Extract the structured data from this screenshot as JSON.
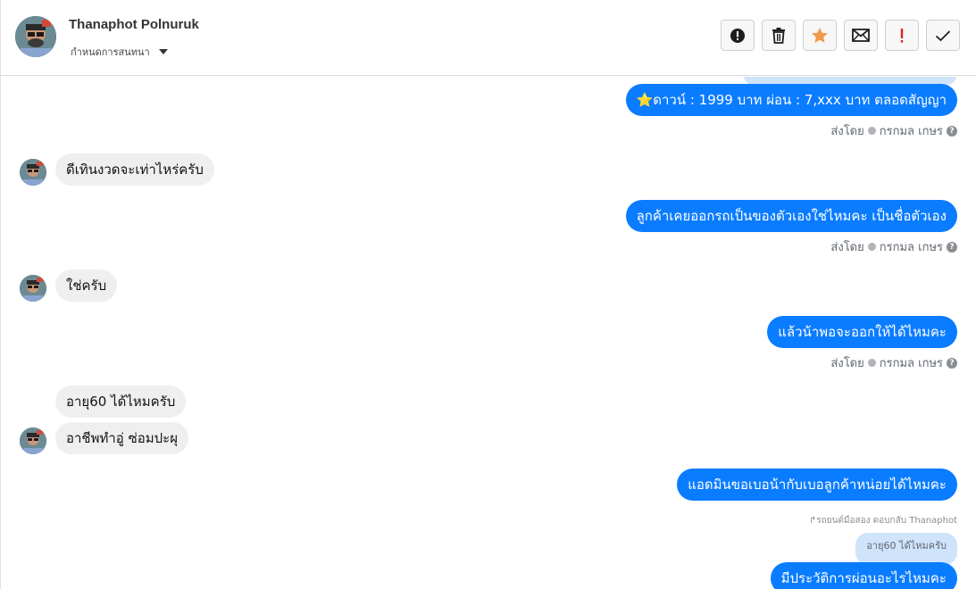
{
  "header": {
    "name": "Thanaphot Polnuruk",
    "assign_label": "กำหนดการสนทนา"
  },
  "actions": [
    {
      "name": "alert-icon",
      "color": "#1c1e21"
    },
    {
      "name": "trash-icon",
      "color": "#1c1e21"
    },
    {
      "name": "star-icon",
      "color": "#f2994a"
    },
    {
      "name": "mail-icon",
      "color": "#1c1e21"
    },
    {
      "name": "exclamation-icon",
      "color": "#e02020"
    },
    {
      "name": "check-icon",
      "color": "#1c1e21"
    }
  ],
  "colors": {
    "outgoing_bubble": "#0a7cff",
    "incoming_bubble": "#efefef",
    "quoted_bubble": "#cfe3fb"
  },
  "messages": {
    "out1": "⭐ดาวน์ : 1999 บาท ผ่อน : 7,xxx บาท ตลอดสัญญา",
    "in1": "ดีเทินงวดจะเท่าไหร่ครับ",
    "out2": "ลูกค้าเคยออกรถเป็นของตัวเองใช่ไหมคะ เป็นชื่อตัวเอง",
    "in2": "ใช่ครับ",
    "out3": "แล้วน้าพอจะออกให้ได้ไหมคะ",
    "in3a": "อายุ60 ได้ไหมครับ",
    "in3b": "อาชีพทำอู่ ซ่อมปะผุ",
    "out4": "แอดมินขอเบอน้ากับเบอลูกค้าหน่อยได้ไหมคะ",
    "reply_note": "↱รถยนต์มือสอง ตอบกลับ Thanaphot",
    "quoted": "อายุ60 ได้ไหมครับ",
    "out5": "มีประวัติการผ่อนอะไรไหมคะ"
  },
  "sent_by": {
    "prefix": "ส่งโดย",
    "agent": "กรกมล เกษร",
    "help": "?"
  }
}
